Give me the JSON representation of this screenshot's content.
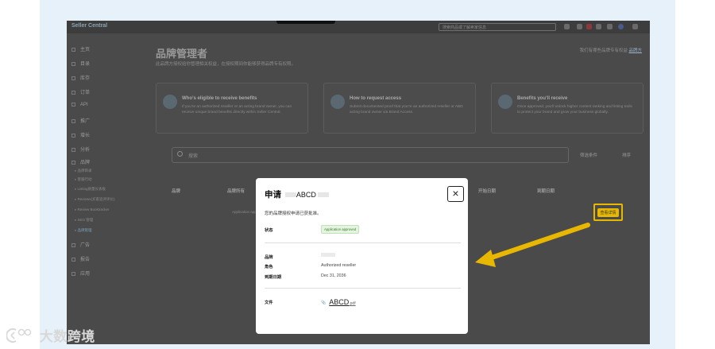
{
  "app": {
    "logo_text": "Seller Central",
    "search_placeholder": "搜索商品或了解卖家信息"
  },
  "sidebar": {
    "items": [
      {
        "label": "主页"
      },
      {
        "label": "目录"
      },
      {
        "label": "库存"
      },
      {
        "label": "订单"
      },
      {
        "label": "API"
      },
      {
        "label": "推广"
      },
      {
        "label": "增长"
      },
      {
        "label": "分析"
      },
      {
        "label": "品牌"
      }
    ],
    "subitems": [
      {
        "label": "品牌目录"
      },
      {
        "label": "客服行动"
      },
      {
        "label": "Listing质量仪表板"
      },
      {
        "label": "Reviews(买家追评评价)"
      },
      {
        "label": "Review Booktracker"
      },
      {
        "label": "SEO 管理"
      },
      {
        "label": "品牌管理"
      }
    ],
    "items_after": [
      {
        "label": "广告"
      },
      {
        "label": "报告"
      },
      {
        "label": "应用"
      }
    ]
  },
  "main": {
    "title": "品牌管理者",
    "description": "此品牌方授权给你管理相关权益，在授权期间你能够获得品牌专有权限。",
    "help_text": "我们有哪些品牌专有权益",
    "help_link": "品牌方"
  },
  "cards": [
    {
      "title": "Who’s eligible to receive benefits",
      "body": "If you’re an authorized reseller or an acting brand owner, you can receive unique brand benefits directly within Seller Central."
    },
    {
      "title": "How to request access",
      "body": "Submit documented proof that you’re an authorized reseller or ABD acting brand owner via Brand Access.",
      "extra": "Invite brand owners"
    },
    {
      "title": "Benefits you’ll receive",
      "body": "Once approved, you’ll unlock higher content ranking and listing tools to protect your brand and grow your business globally."
    }
  ],
  "filters": {
    "search_placeholder": "搜索",
    "filter_button": "筛选条件",
    "sort_button": "排序"
  },
  "table": {
    "columns": [
      "品牌",
      "品牌所有",
      "开始日期",
      "到期日期"
    ],
    "row_cell": "Application approved",
    "action_button": "查看详情"
  },
  "modal": {
    "title": "申请",
    "title_brand": "ABCD",
    "description": "您的品牌授权申请已获批准。",
    "status_label": "状态",
    "status_value": "Application approved",
    "brand_label": "品牌",
    "role_label": "角色",
    "role_value": "Authorized reseller",
    "expiry_label": "到期日期",
    "expiry_value": "Dec 31, 2036",
    "file_label": "文件",
    "file_name": "ABCD",
    "file_ext": ".pdf",
    "close_symbol": "×"
  },
  "watermark": {
    "text": "大数跨境"
  },
  "colors": {
    "highlight": "#e8b800",
    "badge_bg": "#e4f4e0",
    "badge_text": "#3b7a2a",
    "overlay": "#4a4a4a",
    "page_bg": "#e7f1f9"
  }
}
